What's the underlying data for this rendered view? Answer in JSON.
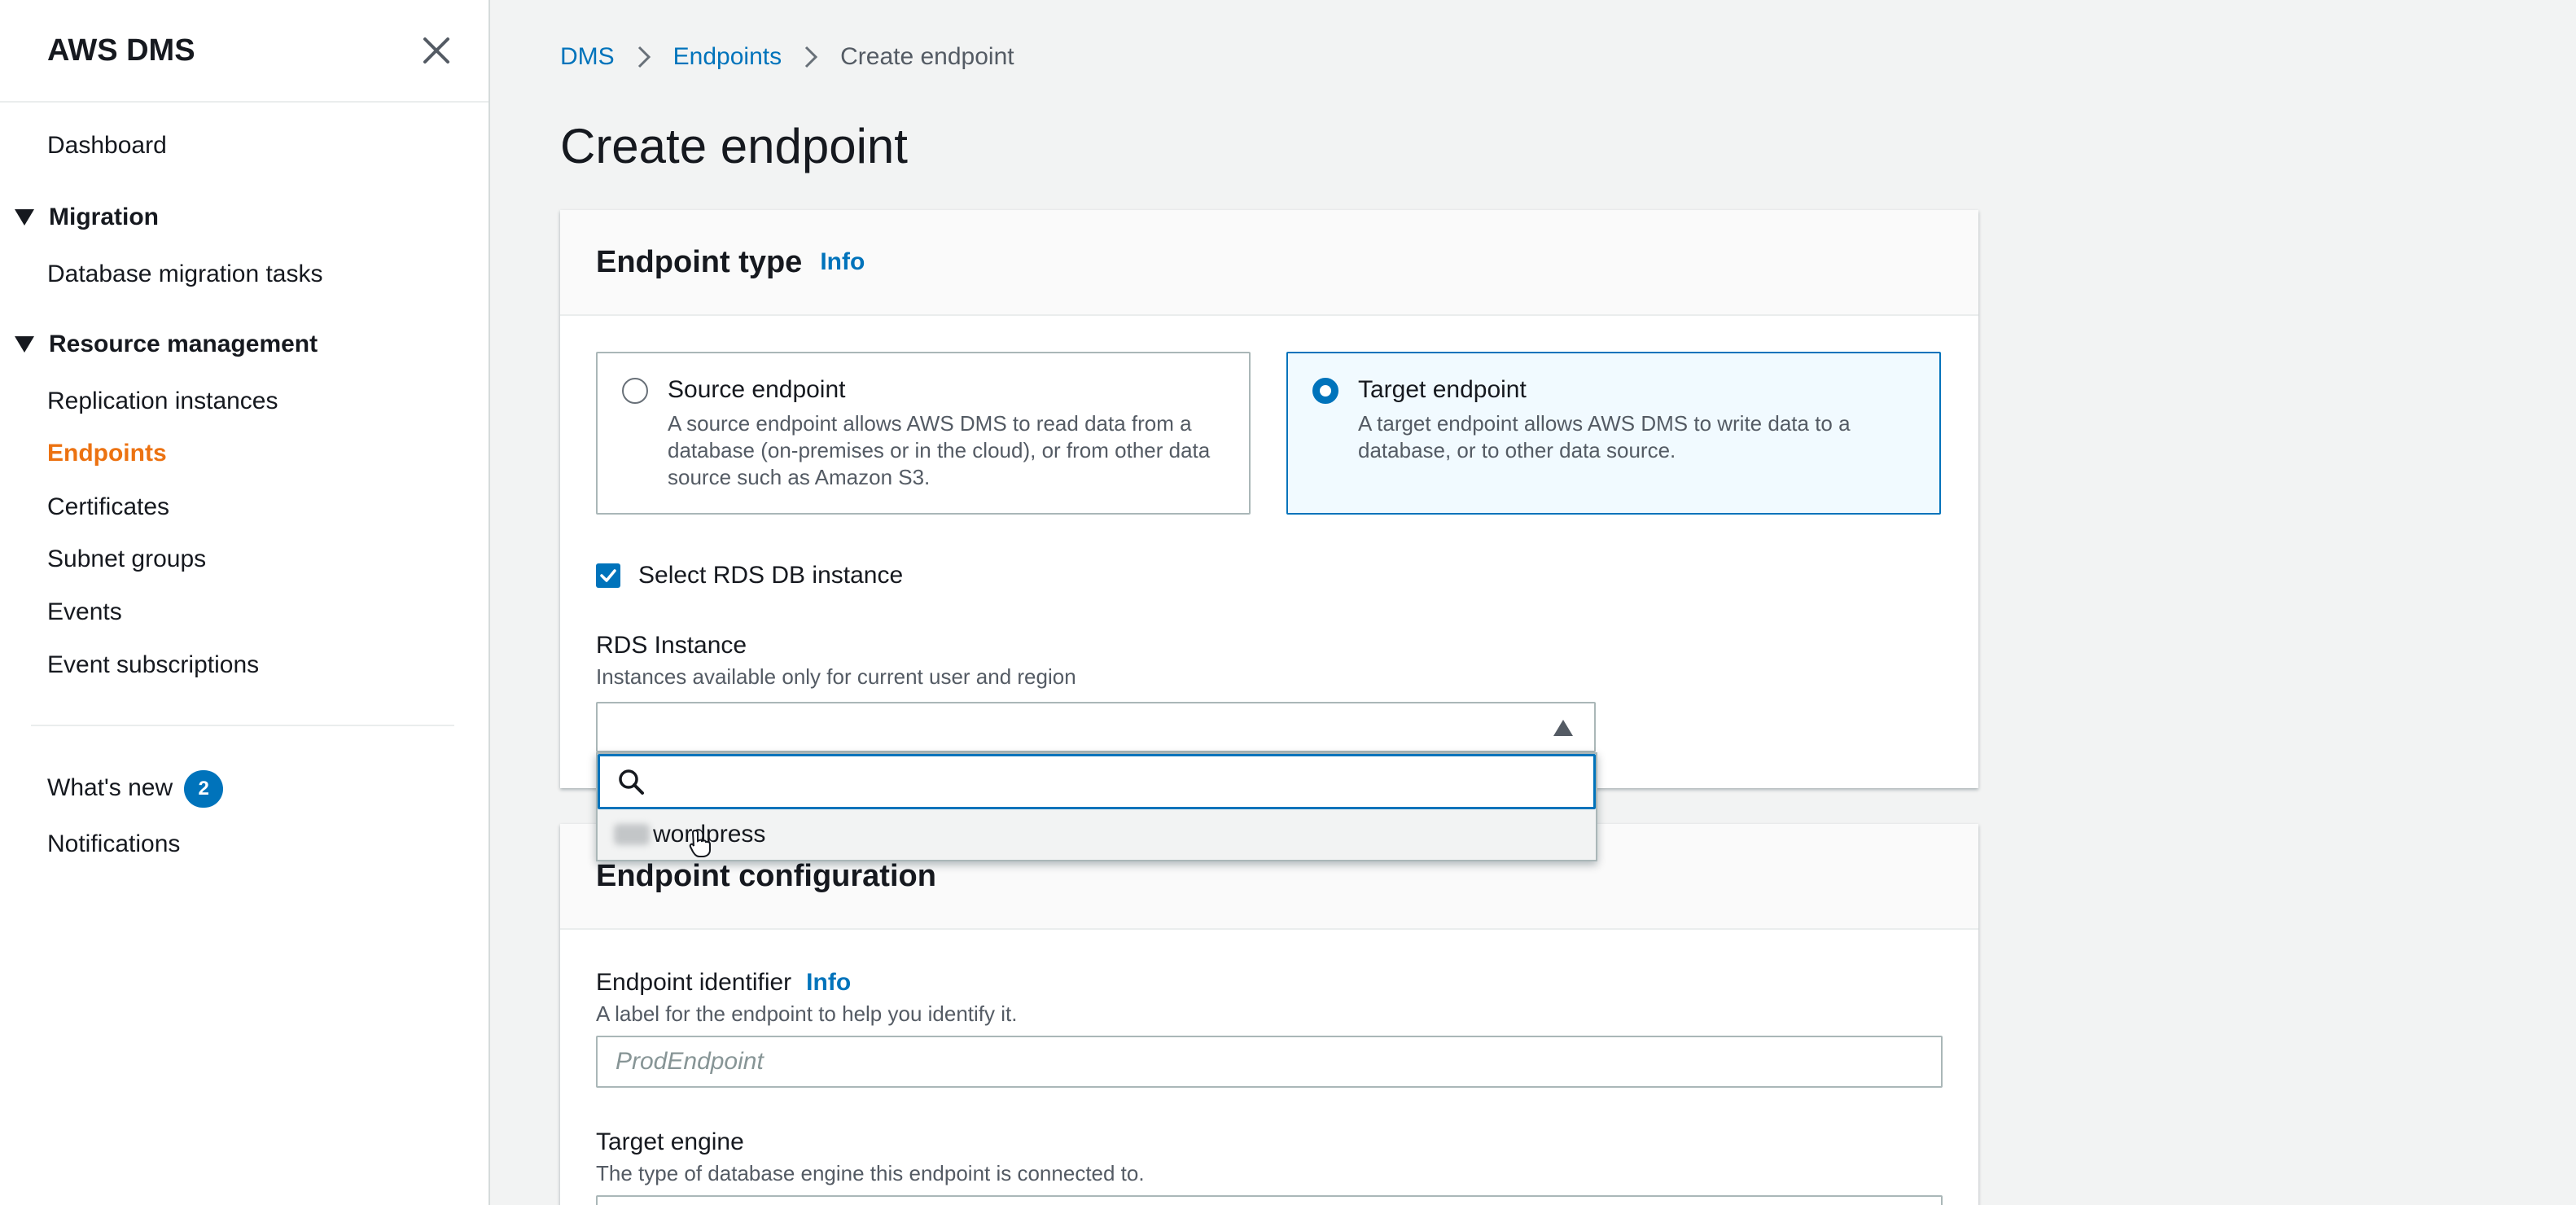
{
  "sidebar": {
    "title": "AWS DMS",
    "items": {
      "dashboard": "Dashboard",
      "migration_section": "Migration",
      "database_migration_tasks": "Database migration tasks",
      "resource_management_section": "Resource management",
      "replication_instances": "Replication instances",
      "endpoints": "Endpoints",
      "certificates": "Certificates",
      "subnet_groups": "Subnet groups",
      "events": "Events",
      "event_subscriptions": "Event subscriptions",
      "whats_new": "What's new",
      "whats_new_count": "2",
      "notifications": "Notifications"
    },
    "active_item": "Endpoints"
  },
  "breadcrumb": {
    "items": [
      "DMS",
      "Endpoints",
      "Create endpoint"
    ]
  },
  "page": {
    "title": "Create endpoint"
  },
  "endpoint_type": {
    "heading": "Endpoint type",
    "info": "Info",
    "source": {
      "title": "Source endpoint",
      "description": "A source endpoint allows AWS DMS to read data from a database (on-premises or in the cloud), or from other data source such as Amazon S3.",
      "selected": false
    },
    "target": {
      "title": "Target endpoint",
      "description": "A target endpoint allows AWS DMS to write data to a database, or to other data source.",
      "selected": true
    },
    "select_rds_label": "Select RDS DB instance",
    "select_rds_checked": true,
    "rds_instance": {
      "label": "RDS Instance",
      "description": "Instances available only for current user and region",
      "search_value": "",
      "options": [
        "wordpress"
      ]
    }
  },
  "endpoint_configuration": {
    "heading": "Endpoint configuration",
    "identifier": {
      "label": "Endpoint identifier",
      "info": "Info",
      "description": "A label for the endpoint to help you identify it.",
      "placeholder": "ProdEndpoint"
    },
    "target_engine": {
      "label": "Target engine",
      "description": "The type of database engine this endpoint is connected to."
    }
  },
  "colors": {
    "link": "#0073bb",
    "active_nav": "#ec7211",
    "selected_tile_bg": "#f1faff"
  }
}
